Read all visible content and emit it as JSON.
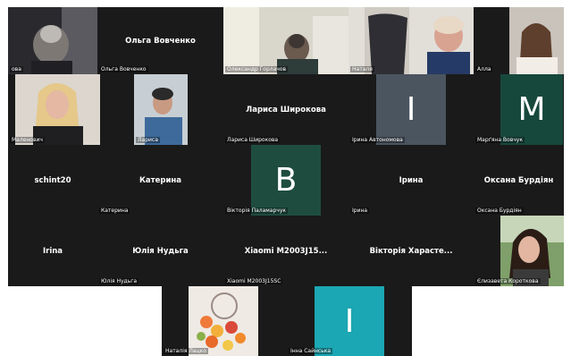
{
  "colors": {
    "background": "#ffffff",
    "tile": "#1a1a1a",
    "text": "#ffffff",
    "avatar_gray": "#4b5560",
    "avatar_green": "#17483c",
    "avatar_teal": "#1ba7b3",
    "avatar_darkgreen": "#1e4d3f"
  },
  "participants": [
    {
      "id": "r1c1",
      "label": "ова",
      "video": true
    },
    {
      "id": "r1c2",
      "center_name": "Ольга Вовченко",
      "label": "Ольга Вовченко"
    },
    {
      "id": "r1c3",
      "label": "Олександр Горлачов",
      "video": true
    },
    {
      "id": "r1c4",
      "label": "Наталя",
      "video": true
    },
    {
      "id": "r1c5",
      "label": "Алла",
      "video": true
    },
    {
      "id": "r2c1",
      "label": "Маленович",
      "video": true
    },
    {
      "id": "r2c2",
      "label": "Лариса",
      "video": true
    },
    {
      "id": "r2c3",
      "center_name": "Лариса Широкова",
      "label": "Лариса Широкова"
    },
    {
      "id": "r2c4",
      "avatar": "І",
      "label": "Ірина Автономова"
    },
    {
      "id": "r2c5",
      "avatar": "М",
      "label": "Марґяна Вовчук"
    },
    {
      "id": "r3c1",
      "center_name": "schint20",
      "label": ""
    },
    {
      "id": "r3c2",
      "center_name": "Катерина",
      "label": "Катерина"
    },
    {
      "id": "r3c3",
      "avatar": "В",
      "label": "Вікторія Паламарчук"
    },
    {
      "id": "r3c4",
      "center_name": "Ірина",
      "label": "Ірина"
    },
    {
      "id": "r3c5",
      "center_name": "Оксана Бурдіян",
      "label": "Оксана Бурдіян"
    },
    {
      "id": "r4c1",
      "center_name": "Irina",
      "label": ""
    },
    {
      "id": "r4c2",
      "center_name": "Юлія Нудьга",
      "label": "Юлія Нудьга"
    },
    {
      "id": "r4c3",
      "center_name": "Xiaomi  M2003J15...",
      "label": "Xiaomi M2003J15SC"
    },
    {
      "id": "r4c4",
      "center_name": "Вікторія  Харасте...",
      "label": ""
    },
    {
      "id": "r4c5",
      "label": "Єлизавета Короткова",
      "video": true
    },
    {
      "id": "r5c1",
      "label": "Наталія Лацко",
      "video": true
    },
    {
      "id": "r5c2",
      "avatar": "І",
      "label": "Інна Сайнська"
    }
  ]
}
